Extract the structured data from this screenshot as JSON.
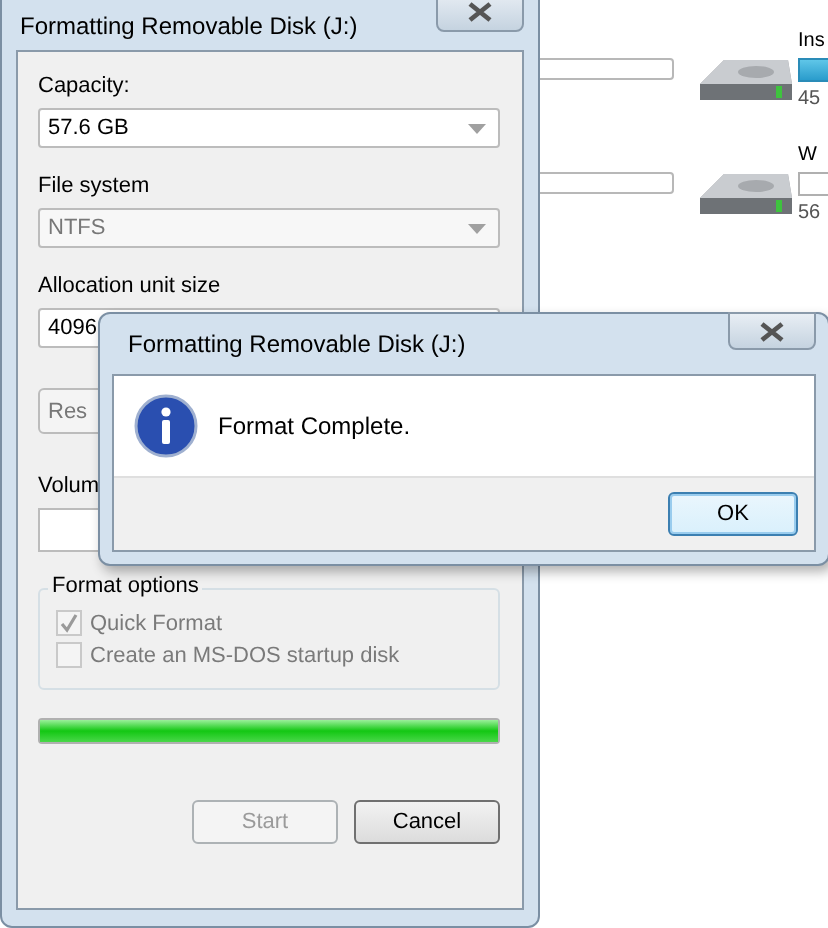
{
  "background_drives": [
    {
      "name": "Ins",
      "size": "45",
      "bar_filled": true
    },
    {
      "name": "W",
      "size": "56",
      "bar_filled": false
    }
  ],
  "format_window": {
    "title": "Formatting Removable Disk (J:)",
    "capacity": {
      "label": "Capacity:",
      "value": "57.6 GB",
      "disabled": false
    },
    "file_system": {
      "label": "File system",
      "value": "NTFS",
      "disabled": true
    },
    "allocation_unit_size": {
      "label": "Allocation unit size",
      "value": "4096",
      "disabled": false
    },
    "restore_button": "Res",
    "volume_label": {
      "label": "Volum"
    },
    "format_options": {
      "title": "Format options",
      "options": [
        {
          "label": "Quick Format",
          "checked": true,
          "disabled": true
        },
        {
          "label": "Create an MS-DOS startup disk",
          "checked": false,
          "disabled": true
        }
      ]
    },
    "progress": {
      "level": 1
    },
    "buttons": [
      {
        "label": "Start",
        "disabled": true
      },
      {
        "label": "Cancel",
        "disabled": false
      }
    ]
  },
  "message_dialog": {
    "title": "Formatting Removable Disk (J:)",
    "message": "Format Complete.",
    "button": "OK"
  }
}
